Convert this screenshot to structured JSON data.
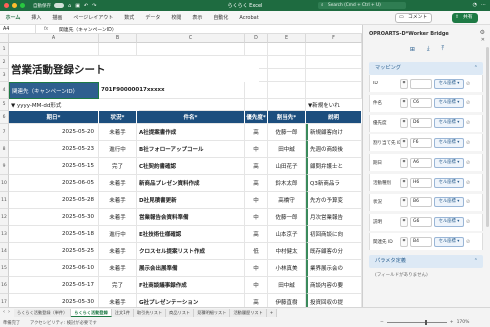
{
  "titlebar": {
    "autosave": "自動保存",
    "title": "らくらく Excel",
    "search": "Search (Cmd + Ctrl + U)"
  },
  "ribbon": {
    "tabs": [
      "ホーム",
      "挿入",
      "描画",
      "ページレイアウト",
      "数式",
      "データ",
      "校閲",
      "表示",
      "自動化",
      "Acrobat"
    ],
    "active_tab": "ホーム",
    "comment": "コメント",
    "share": "共有"
  },
  "formula_bar": {
    "name_box": "A4",
    "fx": "fx",
    "formula": "関連先（キャンペーンID）"
  },
  "grid": {
    "columns": [
      "A",
      "B",
      "C",
      "D",
      "E",
      "F"
    ],
    "rows": [
      "1",
      "2",
      "3",
      "4",
      "5",
      "6",
      "7",
      "8",
      "9",
      "10",
      "11",
      "12",
      "13",
      "14",
      "15",
      "16",
      "17",
      "18"
    ],
    "sheet_title": "営業活動登録シート",
    "related_label": "関連先（キャンペーンID）",
    "related_value": "701F90000017xxxxx",
    "date_format_note": "yyyy-MM-dd形式",
    "f_note": "新規をいれ",
    "headers": [
      "期日*",
      "状況*",
      "件名*",
      "優先度*",
      "割当先*",
      "説明"
    ],
    "data_rows": [
      [
        "2025-05-20",
        "未着手",
        "A社提案書作成",
        "高",
        "佐藤一郎",
        "新規顧客向け"
      ],
      [
        "2025-05-23",
        "進行中",
        "B社フォローアップコール",
        "中",
        "田中誠",
        "先週の商談後"
      ],
      [
        "2025-05-15",
        "完了",
        "C社契約書確認",
        "高",
        "山田花子",
        "顧問弁護士と"
      ],
      [
        "2025-06-05",
        "未着手",
        "新商品プレゼン資料作成",
        "高",
        "鈴木太郎",
        "Q3新商品ラ"
      ],
      [
        "2025-05-28",
        "未着手",
        "D社見積書更新",
        "中",
        "高橋守",
        "先方の予算変"
      ],
      [
        "2025-05-30",
        "未着手",
        "営業報告会資料準備",
        "中",
        "佐藤一郎",
        "月次営業報告"
      ],
      [
        "2025-05-18",
        "進行中",
        "E社技術仕様確認",
        "高",
        "山本京子",
        "初回商談に向"
      ],
      [
        "2025-05-25",
        "未着手",
        "クロスセル提案リスト作成",
        "低",
        "中村健太",
        "既存顧客の分"
      ],
      [
        "2025-06-10",
        "未着手",
        "展示会出展準備",
        "中",
        "小林真美",
        "業界展示会の"
      ],
      [
        "2025-05-17",
        "完了",
        "F社商談議事録作成",
        "中",
        "田中誠",
        "商談内容の要"
      ],
      [
        "2025-05-30",
        "未着手",
        "G社プレゼンテーション",
        "高",
        "伊藤直樹",
        "投資回収の提"
      ]
    ]
  },
  "pane": {
    "title": "OPROARTS-D*Worker Bridge",
    "mapping_label": "マッピング",
    "mappings": [
      {
        "label": "ID",
        "cell": "",
        "select": "セル座標"
      },
      {
        "label": "件名",
        "cell": "C6",
        "select": "セル座標"
      },
      {
        "label": "優先度",
        "cell": "D6",
        "select": "セル座標"
      },
      {
        "label": "割り当て先 ID",
        "cell": "F6",
        "select": "セル座標"
      },
      {
        "label": "期日",
        "cell": "A6",
        "select": "セル座標"
      },
      {
        "label": "活動種別",
        "cell": "H6",
        "select": "セル座標"
      },
      {
        "label": "状況",
        "cell": "B6",
        "select": "セル座標"
      },
      {
        "label": "説明",
        "cell": "G6",
        "select": "セル座標"
      },
      {
        "label": "関連先 ID",
        "cell": "B4",
        "select": "セル座標"
      }
    ],
    "param_label": "パラメタ定義",
    "param_note": "(フィールドがありません)"
  },
  "status": {
    "ready": "準備完了",
    "accessibility": "アクセシビリティ: 検討が必要です",
    "sheets": [
      "らくらく活動登録（単件）",
      "らくらく活動登録",
      "注文1件",
      "取引先リスト",
      "商品リスト",
      "見積明細リスト",
      "活動履歴リスト"
    ],
    "active_sheet": "らくらく活動登録",
    "zoom": "170%"
  },
  "colors": {
    "titlebar": "#1e6b40",
    "header_fill": "#1c4e7e",
    "accent": "#1e7a45"
  }
}
